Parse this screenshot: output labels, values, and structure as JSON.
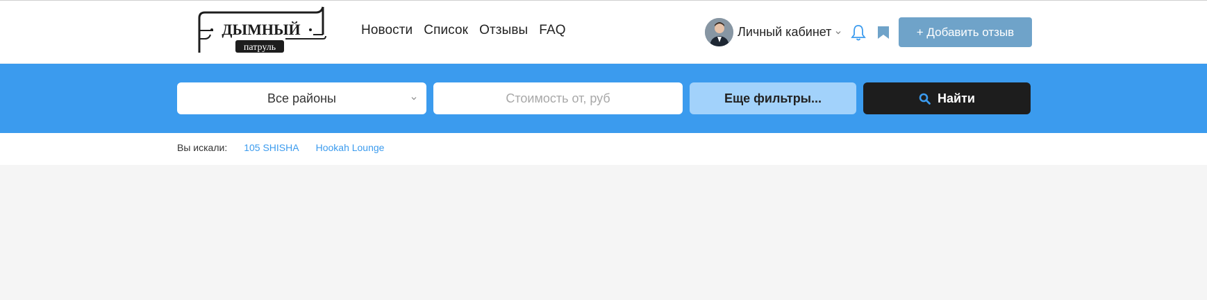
{
  "logo": {
    "title": "ДЫМНЫЙ",
    "subtitle": "патруль"
  },
  "nav": [
    {
      "label": "Новости"
    },
    {
      "label": "Список"
    },
    {
      "label": "Отзывы"
    },
    {
      "label": "FAQ"
    }
  ],
  "account": {
    "label": "Личный кабинет"
  },
  "add_review_label": "+ Добавить отзыв",
  "filters": {
    "district": "Все районы",
    "price_placeholder": "Стоимость от, руб",
    "more": "Еще фильтры...",
    "find": "Найти"
  },
  "searched": {
    "label": "Вы искали:",
    "tags": [
      "105 SHISHA",
      "Hookah Lounge"
    ]
  },
  "colors": {
    "band": "#3b9bee",
    "add_button": "#6fa3c9",
    "more_filters": "#a2d2fb",
    "find_button": "#1d1d1d"
  }
}
